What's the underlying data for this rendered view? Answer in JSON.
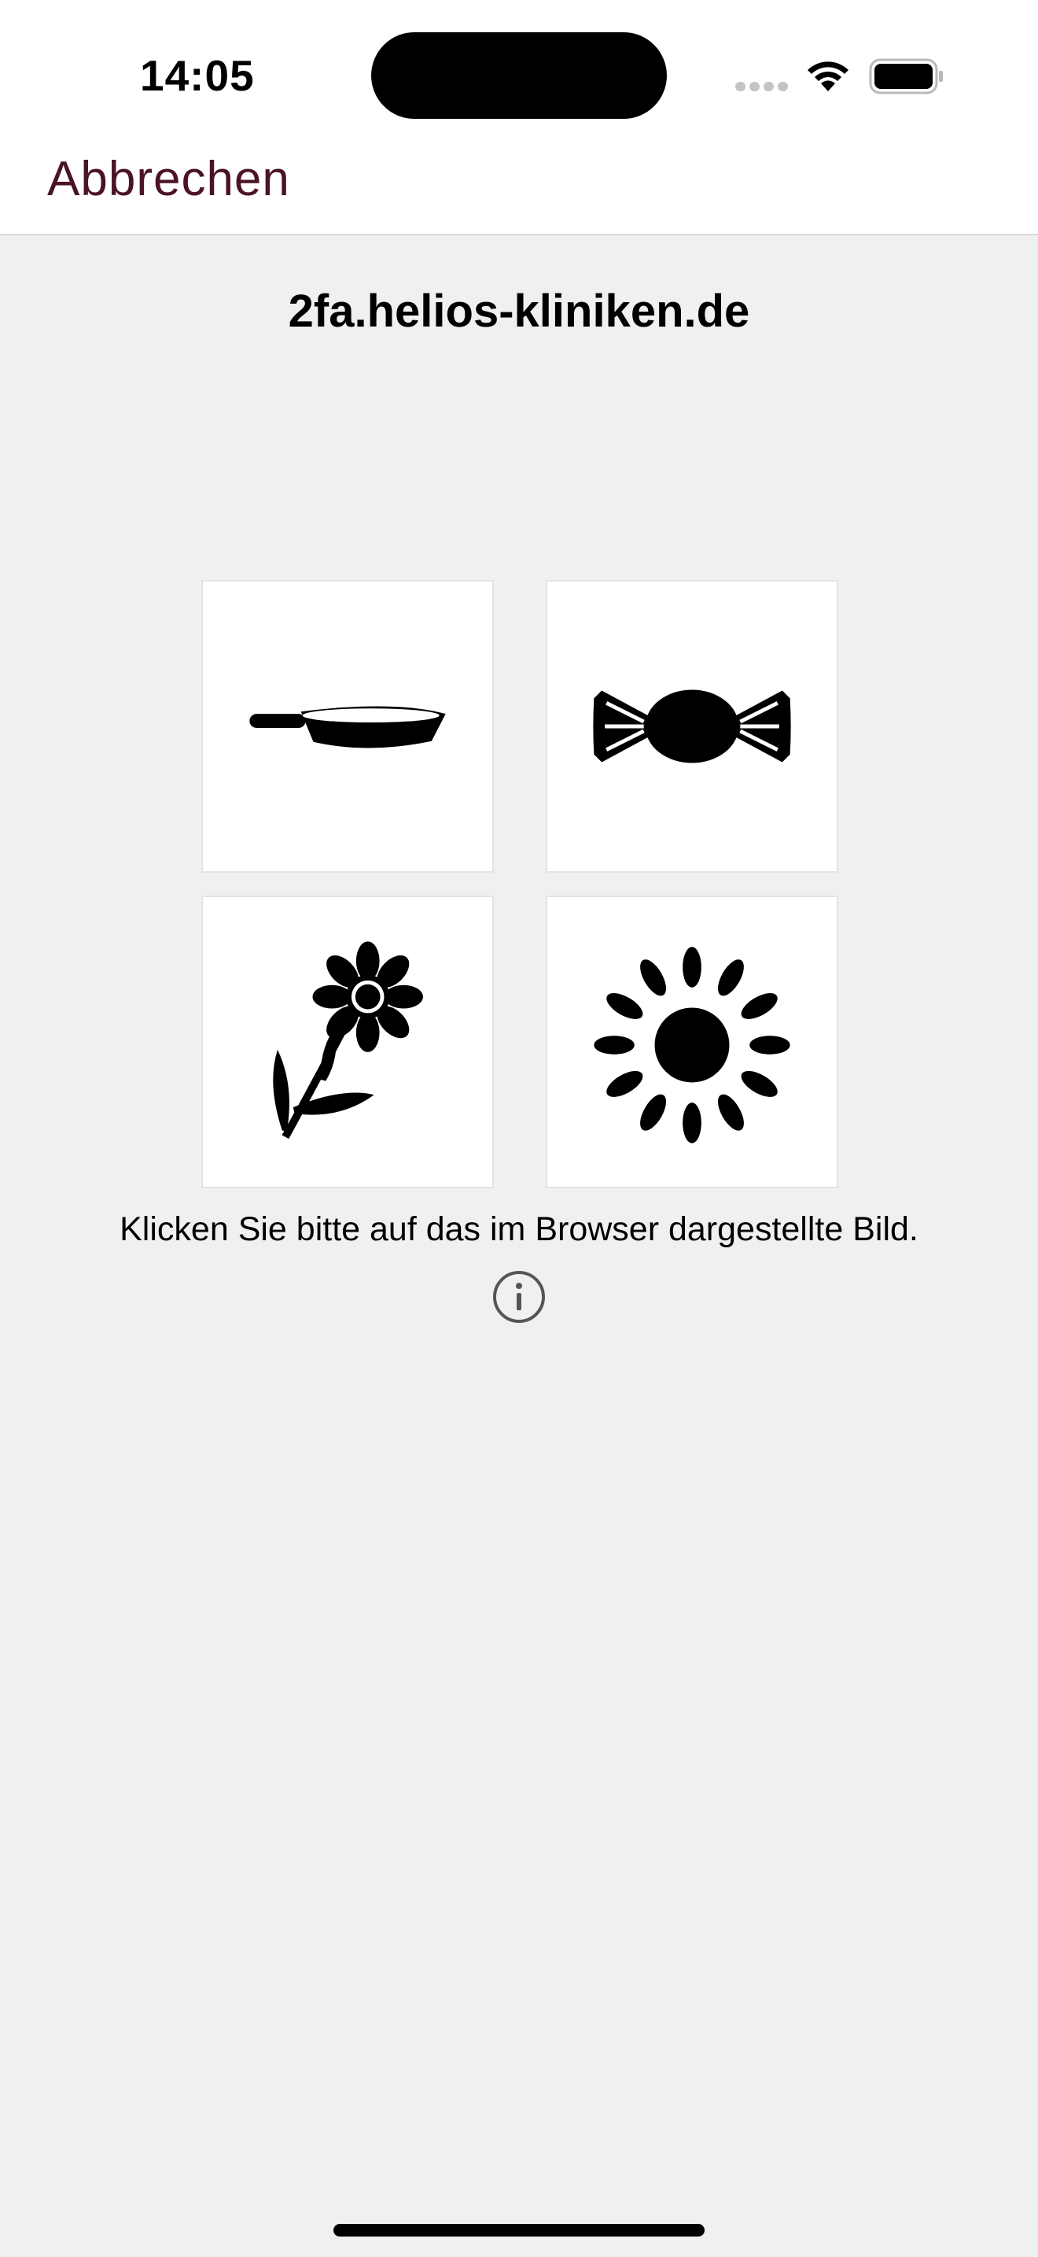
{
  "status_bar": {
    "time": "14:05",
    "signal_icon": "cellular-signal-icon",
    "wifi_icon": "wifi-icon",
    "battery_icon": "battery-icon"
  },
  "nav": {
    "cancel_label": "Abbrechen"
  },
  "page": {
    "domain": "2fa.helios-kliniken.de",
    "instruction": "Klicken Sie bitte auf das im Browser dargestellte Bild.",
    "info_icon": "info-icon"
  },
  "choices": [
    {
      "icon": "frying-pan-icon"
    },
    {
      "icon": "candy-icon"
    },
    {
      "icon": "flower-icon"
    },
    {
      "icon": "sun-icon"
    }
  ],
  "colors": {
    "accent": "#4a1426",
    "background": "#eff0f2",
    "tile_background": "#ffffff",
    "icon": "#000000"
  }
}
